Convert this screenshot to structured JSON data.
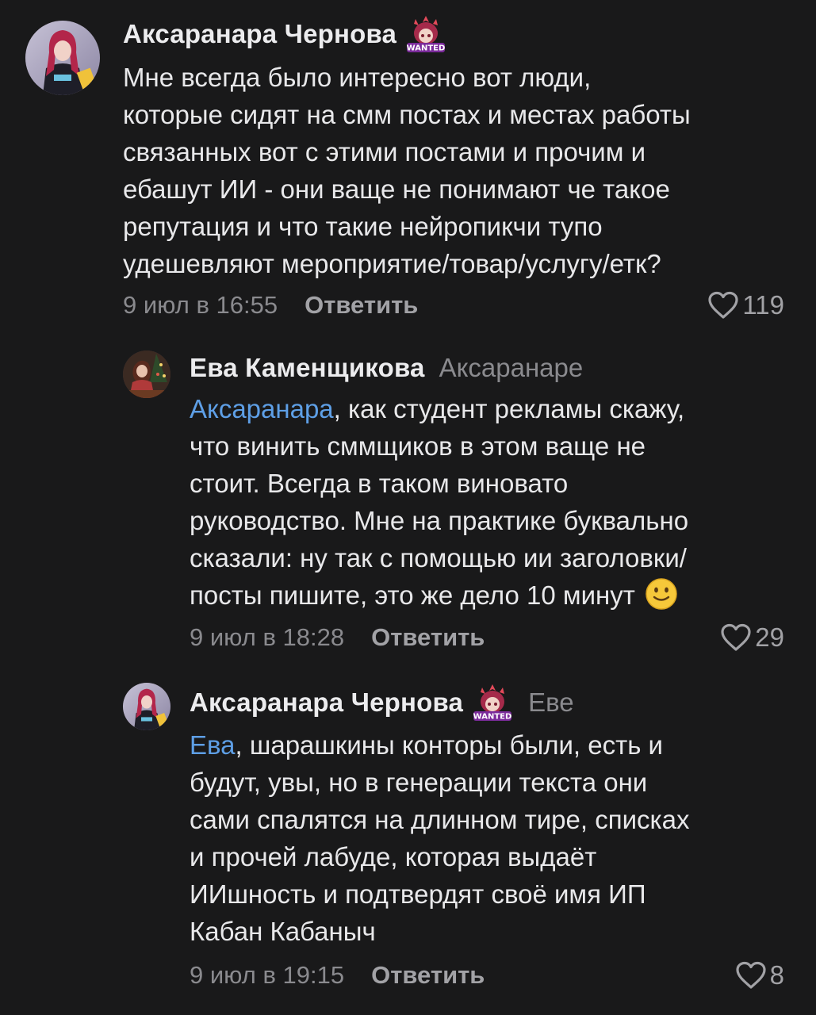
{
  "comments": [
    {
      "author": "Аксаранара Чернова",
      "badge_text": "WANTED",
      "reply_to": "",
      "mention": "",
      "text": "Мне всегда было интересно вот люди,\nкоторые сидят на смм постах и местах работы\nсвязанных вот с этими постами и прочим и\nебашут ИИ - они ваще не понимают че такое\nрепутация и что такие нейропикчи тупо\nудешевляют мероприятие/товар/услугу/етк?",
      "timestamp": "9 июл в 16:55",
      "reply_label": "Ответить",
      "likes": "119"
    },
    {
      "author": "Ева Каменщикова",
      "reply_to": "Аксаранаре",
      "mention": "Аксаранара",
      "text": ", как студент рекламы скажу,\nчто винить сммщиков в этом ваще не\nстоит. Всегда в таком виновато\nруководство. Мне на практике буквально\nсказали: ну так с помощью ии заголовки/\nпосты пишите, это же дело 10 минут",
      "emoji": "slightly-smiling-face",
      "timestamp": "9 июл в 18:28",
      "reply_label": "Ответить",
      "likes": "29"
    },
    {
      "author": "Аксаранара Чернова",
      "badge_text": "WANTED",
      "reply_to": "Еве",
      "mention": "Ева",
      "text": ", шарашкины конторы были, есть и\nбудут, увы, но в генерации текста они\nсами спалятся на длинном тире, списках\nи прочей лабуде, которая выдаёт\nИИшность и подтвердят своё имя ИП\nКабан Кабаныч",
      "timestamp": "9 июл в 19:15",
      "reply_label": "Ответить",
      "likes": "8"
    }
  ],
  "colors": {
    "background": "#19191a",
    "text": "#e8e8ea",
    "secondary": "#8a8a8e",
    "mention": "#5e9fe6"
  },
  "icons": {
    "like": "heart-outline-icon",
    "badge": "wanted-sticker-icon",
    "emoji": "slightly-smiling-face-emoji"
  }
}
